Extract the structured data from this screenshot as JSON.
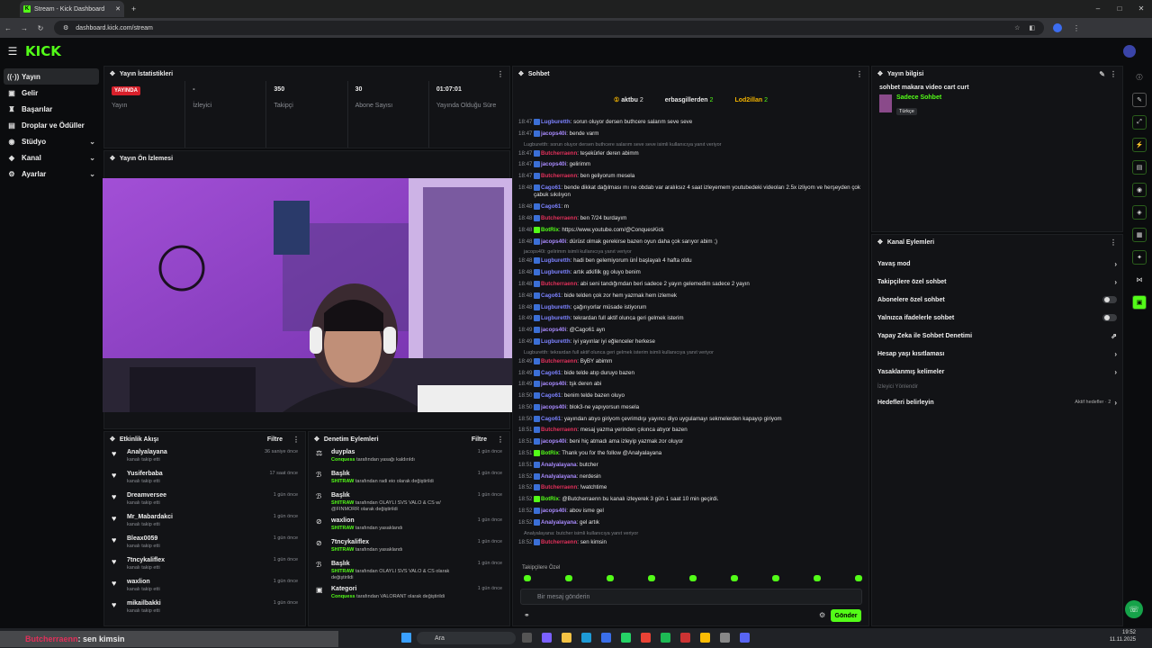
{
  "browser": {
    "tab_title": "Stream - Kick Dashboard",
    "url": "dashboard.kick.com/stream"
  },
  "kick": {
    "logo": "KICK"
  },
  "sidebar": {
    "items": [
      {
        "label": "Yayın",
        "icon": "signal-icon"
      },
      {
        "label": "Gelir",
        "icon": "wallet-icon"
      },
      {
        "label": "Başarılar",
        "icon": "trophy-icon"
      },
      {
        "label": "Droplar ve Ödüller",
        "icon": "gift-icon"
      },
      {
        "label": "Stüdyo",
        "icon": "studio-icon"
      },
      {
        "label": "Kanal",
        "icon": "channel-icon"
      },
      {
        "label": "Ayarlar",
        "icon": "gear-icon"
      }
    ]
  },
  "stats": {
    "title": "Yayın İstatistikleri",
    "live": "YAYINDA",
    "items": [
      {
        "value": "",
        "label": "Yayın"
      },
      {
        "value": "-",
        "label": "İzleyici"
      },
      {
        "value": "350",
        "label": "Takipçi"
      },
      {
        "value": "30",
        "label": "Abone Sayısı"
      },
      {
        "value": "01:07:01",
        "label": "Yayında Olduğu Süre"
      }
    ]
  },
  "preview": {
    "title": "Yayın Ön İzlemesi"
  },
  "activity": {
    "title": "Etkinlik Akışı",
    "filter": "Filtre",
    "items": [
      {
        "name": "Analyalayana",
        "sub": "kanalı takip etti",
        "time": "36 saniye önce"
      },
      {
        "name": "Yusiferbaba",
        "sub": "kanalı takip etti",
        "time": "17 saat önce"
      },
      {
        "name": "Dreamversee",
        "sub": "kanalı takip etti",
        "time": "1 gün önce"
      },
      {
        "name": "Mr_Mabardakci",
        "sub": "kanalı takip etti",
        "time": "1 gün önce"
      },
      {
        "name": "Bleax0059",
        "sub": "kanalı takip etti",
        "time": "1 gün önce"
      },
      {
        "name": "7tncykaliflex",
        "sub": "kanalı takip etti",
        "time": "1 gün önce"
      },
      {
        "name": "waxlion",
        "sub": "kanalı takip etti",
        "time": "1 gün önce"
      },
      {
        "name": "mikailbakki",
        "sub": "kanalı takip etti",
        "time": "1 gün önce"
      }
    ]
  },
  "moderation": {
    "title": "Denetim Eylemleri",
    "filter": "Filtre",
    "items": [
      {
        "name": "duyplas",
        "by": "Conquess",
        "rest": "tarafından yasağı kaldırıldı",
        "time": "1 gün önce"
      },
      {
        "name": "Başlık",
        "by": "SHITRAW",
        "rest": "tarafından radi eio olarak değiştirildi",
        "time": "1 gün önce"
      },
      {
        "name": "Başlık",
        "by": "SHITRAW",
        "rest": "tarafından OLAYLI SVS VALO & CS w/ @FINMORR olarak değiştirildi",
        "time": "1 gün önce"
      },
      {
        "name": "waxlion",
        "by": "SHITRAW",
        "rest": "tarafından yasaklandı",
        "time": "1 gün önce"
      },
      {
        "name": "7tncykaliflex",
        "by": "SHITRAW",
        "rest": "tarafından yasaklandı",
        "time": "1 gün önce"
      },
      {
        "name": "Başlık",
        "by": "SHITRAW",
        "rest": "tarafından OLAYLI SVS VALO & CS olarak değiştirildi",
        "time": "1 gün önce"
      },
      {
        "name": "Kategori",
        "by": "Conquess",
        "rest": "tarafından VALORANT olarak değiştirildi",
        "time": "1 gün önce"
      }
    ]
  },
  "chat": {
    "title": "Sohbet",
    "top": [
      {
        "name": "aktbu",
        "count": "2"
      },
      {
        "name": "erbasgillerden",
        "count": "2"
      },
      {
        "name": "Lod2illan",
        "count": "2"
      }
    ],
    "lines": [
      {
        "time": "18:47",
        "user": "Lugburetth",
        "color": "#7c82ff",
        "msg": "sorun oluyor dersen buthcere salarım seve seve"
      },
      {
        "time": "18:47",
        "user": "jacops40i",
        "color": "#a98bff",
        "msg": "bende varm"
      },
      {
        "reply": "Lugburetth: sorun oluyor dersen buthcere salarım seve seve isimli kullanıcıya yanıt veriyor"
      },
      {
        "time": "18:47",
        "user": "Butcherraenn",
        "color": "#e0305a",
        "msg": "teşekürler deren abimm"
      },
      {
        "time": "18:47",
        "user": "jacops40i",
        "color": "#a98bff",
        "msg": "gelirimm"
      },
      {
        "time": "18:47",
        "user": "Butcherraenn",
        "color": "#e0305a",
        "msg": "ben geliyorum mesela"
      },
      {
        "time": "18:48",
        "user": "Cago61",
        "color": "#7c82ff",
        "msg": "bende dikkat dağılması mı ne obdab var aralıksız 4 saat izleyemem youtubedeki videoları 2.5x izliyom ve herşeyden çok çabuk sıkılıyon"
      },
      {
        "time": "18:48",
        "user": "Cago61",
        "color": "#7c82ff",
        "msg": "m"
      },
      {
        "time": "18:48",
        "user": "Butcherraenn",
        "color": "#e0305a",
        "msg": "ben 7/24 burdayım"
      },
      {
        "time": "18:48",
        "user": "BotRix",
        "color": "#53fc18",
        "msg": "https://www.youtube.com/@ConquesKick"
      },
      {
        "time": "18:48",
        "user": "jacops40i",
        "color": "#a98bff",
        "msg": "dürüst olmak gerekirse bazen oyun daha çok sarıyor abim ;)"
      },
      {
        "reply": "jacops40i: gelirimm isimli kullanıcıya yanıt veriyor"
      },
      {
        "time": "18:48",
        "user": "Lugburetth",
        "color": "#7c82ff",
        "msg": "hadi ben gelemiyorum ünİ başlayalı 4 hafta oldu"
      },
      {
        "time": "18:48",
        "user": "Lugburetth",
        "color": "#7c82ff",
        "msg": "artık atkifilk gg oluyo benim"
      },
      {
        "time": "18:48",
        "user": "Butcherraenn",
        "color": "#e0305a",
        "msg": "abi seni tandığımdan beri sadece 2 yayın gelemedim sadece 2 yayın"
      },
      {
        "time": "18:48",
        "user": "Cago61",
        "color": "#7c82ff",
        "msg": "bide telden çok zor hem yazmak hem izlemek"
      },
      {
        "time": "18:48",
        "user": "Lugburetth",
        "color": "#7c82ff",
        "msg": "çağırıyorlar müsade istiyorum"
      },
      {
        "time": "18:49",
        "user": "Lugburetth",
        "color": "#7c82ff",
        "msg": "tekrardan full aktif olunca geri gelmek isterim"
      },
      {
        "time": "18:49",
        "user": "jacops40i",
        "color": "#a98bff",
        "msg": "@Cago61 ayn"
      },
      {
        "time": "18:49",
        "user": "Lugburetth",
        "color": "#7c82ff",
        "msg": "iyi yayınlar iyi eğlenceler herkese"
      },
      {
        "reply": "Lugburetth: tekrardan full aktif olunca geri gelmek isterim isimli kullanıcıya yanıt veriyor"
      },
      {
        "time": "18:49",
        "user": "Butcherraenn",
        "color": "#e0305a",
        "msg": "ByBY abimm"
      },
      {
        "time": "18:49",
        "user": "Cago61",
        "color": "#7c82ff",
        "msg": "bide telde atıp duruyo bazen"
      },
      {
        "time": "18:49",
        "user": "jacops40i",
        "color": "#a98bff",
        "msg": "tşk deren abi"
      },
      {
        "time": "18:50",
        "user": "Cago61",
        "color": "#7c82ff",
        "msg": "benim telde bazen oluyo"
      },
      {
        "time": "18:50",
        "user": "jacops40i",
        "color": "#a98bff",
        "msg": "blok3-ne yapıyorsun mesela"
      },
      {
        "time": "18:50",
        "user": "Cago61",
        "color": "#7c82ff",
        "msg": "yayından atıyo giriyom çevrimdışı yayıncı diyo uygulamayı sekmelerden kapayıp giriyom"
      },
      {
        "time": "18:51",
        "user": "Butcherraenn",
        "color": "#e0305a",
        "msg": "mesaj yazma yerinden çıkınca atıyor bazen"
      },
      {
        "time": "18:51",
        "user": "jacops40i",
        "color": "#a98bff",
        "msg": "beni hiç atmadı ama izleyip yazmak zor oluyor"
      },
      {
        "time": "18:51",
        "user": "BotRix",
        "color": "#53fc18",
        "msg": "Thank you for the follow @Analyalayana"
      },
      {
        "time": "18:51",
        "user": "Analyalayana",
        "color": "#a98bff",
        "msg": "butcher"
      },
      {
        "time": "18:52",
        "user": "Analyalayana",
        "color": "#a98bff",
        "msg": "nerdesin"
      },
      {
        "time": "18:52",
        "user": "Butcherraenn",
        "color": "#e0305a",
        "msg": "!watchtime"
      },
      {
        "time": "18:52",
        "user": "BotRix",
        "color": "#53fc18",
        "msg": "@Butcherraenn bu kanalı izleyerek 3 gün 1 saat 10 min geçirdi."
      },
      {
        "time": "18:52",
        "user": "jacops40i",
        "color": "#a98bff",
        "msg": "abov isme gel"
      },
      {
        "time": "18:52",
        "user": "Analyalayana",
        "color": "#a98bff",
        "msg": "gel artık"
      },
      {
        "reply": "Analyalayana: butcher isimli kullanıcıya yanıt veriyor"
      },
      {
        "time": "18:52",
        "user": "Butcherraenn",
        "color": "#e0305a",
        "msg": "sen kimsin"
      }
    ],
    "followers_only": "Takipçilere Özel",
    "input_placeholder": "Bir mesaj gönderin",
    "send": "Gönder"
  },
  "stream_info": {
    "title": "Yayın bilgisi",
    "stream_title": "sohbet makara video cart curt",
    "category": "Sadece Sohbet",
    "tag": "Türkçe"
  },
  "channel_actions": {
    "title": "Kanal Eylemleri",
    "items": [
      {
        "label": "Yavaş mod",
        "kind": "arrow"
      },
      {
        "label": "Takipçilere özel sohbet",
        "kind": "arrow"
      },
      {
        "label": "Abonelere özel sohbet",
        "kind": "toggle"
      },
      {
        "label": "Yalnızca ifadelerle sohbet",
        "kind": "toggle"
      },
      {
        "label": "Yapay Zeka ile Sohbet Denetimi",
        "kind": "ext"
      },
      {
        "label": "Hesap yaşı kısıtlaması",
        "kind": "arrow"
      },
      {
        "label": "Yasaklanmış kelimeler",
        "kind": "arrow"
      }
    ],
    "viewer_section": "İzleyici Yönlendir",
    "targets": "Hedefleri belirleyin",
    "targets_status": "Aktif hedefler · 2"
  },
  "ticker": {
    "name": "Butcherraenn",
    "msg": ": sen kimsin"
  },
  "taskbar": {
    "search": "Ara",
    "time": "19:52",
    "date": "11.11.2025"
  }
}
